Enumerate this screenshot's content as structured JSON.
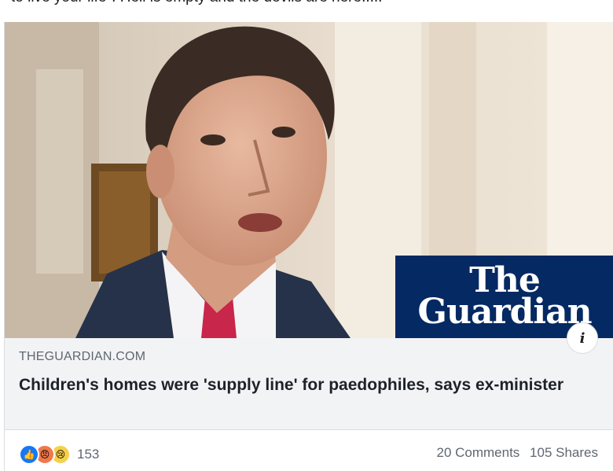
{
  "post": {
    "text": "to live your life\". Hell is empty and the devils are here....."
  },
  "link_card": {
    "brand_line1": "The",
    "brand_line2": "Guardian",
    "info_label": "i",
    "domain": "THEGUARDIAN.COM",
    "headline": "Children's homes were 'supply line' for paedophiles, says ex-minister"
  },
  "engagement": {
    "reaction_icons": [
      "like-icon",
      "angry-icon",
      "sad-icon"
    ],
    "reaction_count": "153",
    "comments": "20 Comments",
    "shares": "105 Shares"
  },
  "colors": {
    "brand_navy": "#052962",
    "like_blue": "#1877f2",
    "meta_bg": "#f2f3f5"
  }
}
